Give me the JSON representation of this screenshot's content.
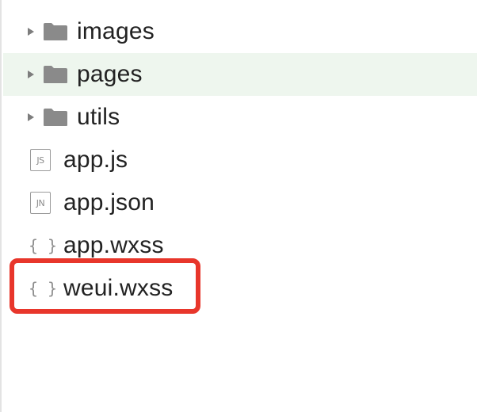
{
  "file_tree": {
    "folders": [
      {
        "label": "images",
        "icon": "folder-icon",
        "expanded": false
      },
      {
        "label": "pages",
        "icon": "folder-icon",
        "expanded": false,
        "selected": true
      },
      {
        "label": "utils",
        "icon": "folder-icon",
        "expanded": false
      }
    ],
    "files": [
      {
        "label": "app.js",
        "icon_text": "JS",
        "icon": "js-file-icon"
      },
      {
        "label": "app.json",
        "icon_text": "JN",
        "icon": "json-file-icon"
      },
      {
        "label": "app.wxss",
        "icon_text": "{ }",
        "icon": "braces-file-icon"
      },
      {
        "label": "weui.wxss",
        "icon_text": "{ }",
        "icon": "braces-file-icon",
        "highlighted": true
      }
    ]
  },
  "colors": {
    "selected_row_background": "#eef6ee",
    "highlight_border": "#e8362b",
    "folder_icon": "#8a8a8a"
  }
}
